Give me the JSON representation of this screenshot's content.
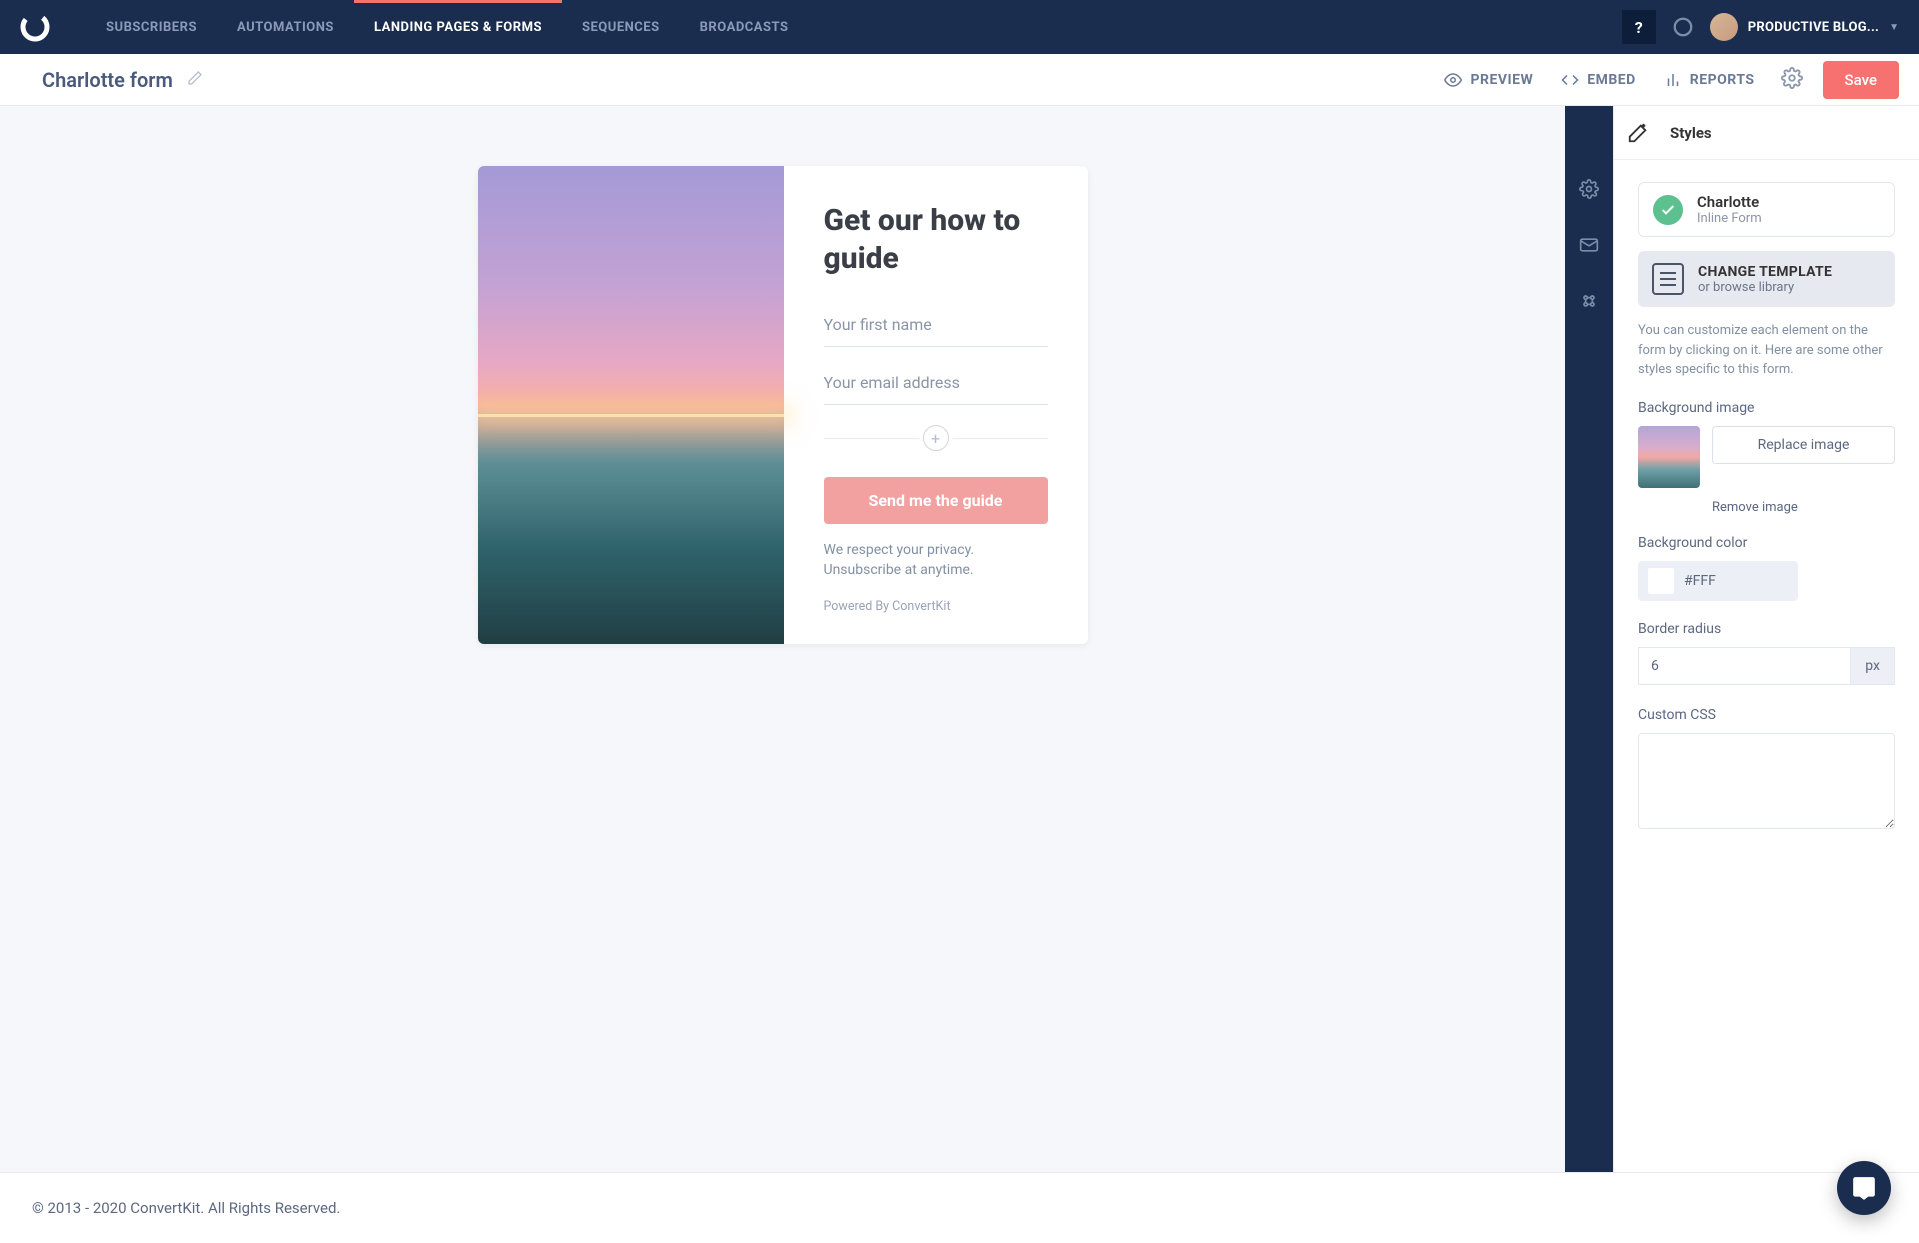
{
  "nav": {
    "items": [
      "SUBSCRIBERS",
      "AUTOMATIONS",
      "LANDING PAGES & FORMS",
      "SEQUENCES",
      "BROADCASTS"
    ],
    "active_index": 2,
    "help_label": "?",
    "user_name": "PRODUCTIVE BLOG..."
  },
  "secondary": {
    "form_name": "Charlotte form",
    "preview": "PREVIEW",
    "embed": "EMBED",
    "reports": "REPORTS",
    "save": "Save"
  },
  "panel": {
    "title": "Styles",
    "template_name": "Charlotte",
    "template_type": "Inline Form",
    "change_template": "CHANGE TEMPLATE",
    "browse_library": "or browse library",
    "help_text": "You can customize each element on the form by clicking on it. Here are some other styles specific to this form.",
    "bg_image_label": "Background image",
    "replace_image": "Replace image",
    "remove_image": "Remove image",
    "bg_color_label": "Background color",
    "bg_color_value": "#FFF",
    "border_radius_label": "Border radius",
    "border_radius_value": "6",
    "border_radius_unit": "px",
    "custom_css_label": "Custom CSS"
  },
  "form": {
    "heading": "Get our how to guide",
    "first_name_placeholder": "Your first name",
    "email_placeholder": "Your email address",
    "submit": "Send me the guide",
    "privacy": "We respect your privacy. Unsubscribe at anytime.",
    "powered": "Powered By ConvertKit"
  },
  "footer": {
    "copyright": "© 2013 - 2020 ConvertKit. All Rights Reserved."
  }
}
